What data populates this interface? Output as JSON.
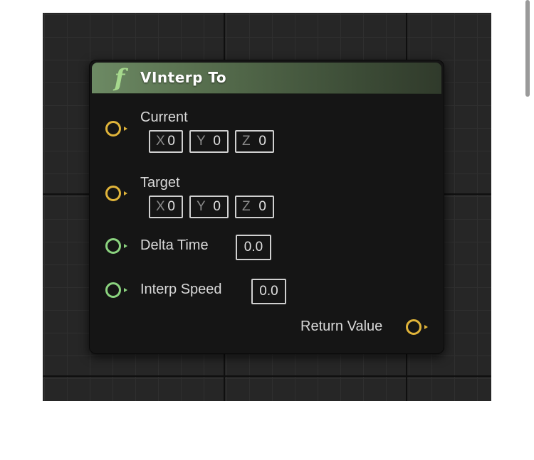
{
  "node": {
    "title": "VInterp To",
    "icon": "function-icon",
    "icon_glyph": "f",
    "header_color": "#5c7654",
    "inputs": [
      {
        "label": "Current",
        "pin_color": "#e0b43a",
        "type": "vector",
        "components": [
          {
            "axis": "X",
            "value": "0"
          },
          {
            "axis": "Y",
            "value": "0"
          },
          {
            "axis": "Z",
            "value": "0"
          }
        ]
      },
      {
        "label": "Target",
        "pin_color": "#e0b43a",
        "type": "vector",
        "components": [
          {
            "axis": "X",
            "value": "0"
          },
          {
            "axis": "Y",
            "value": "0"
          },
          {
            "axis": "Z",
            "value": "0"
          }
        ]
      },
      {
        "label": "Delta Time",
        "pin_color": "#8bd37f",
        "type": "float",
        "value": "0.0"
      },
      {
        "label": "Interp Speed",
        "pin_color": "#8bd37f",
        "type": "float",
        "value": "0.0"
      }
    ],
    "outputs": [
      {
        "label": "Return Value",
        "pin_color": "#e0b43a",
        "type": "vector"
      }
    ]
  },
  "colors": {
    "graph_background": "#262626",
    "node_body": "#151515",
    "vector_pin": "#e0b43a",
    "float_pin": "#8bd37f"
  }
}
